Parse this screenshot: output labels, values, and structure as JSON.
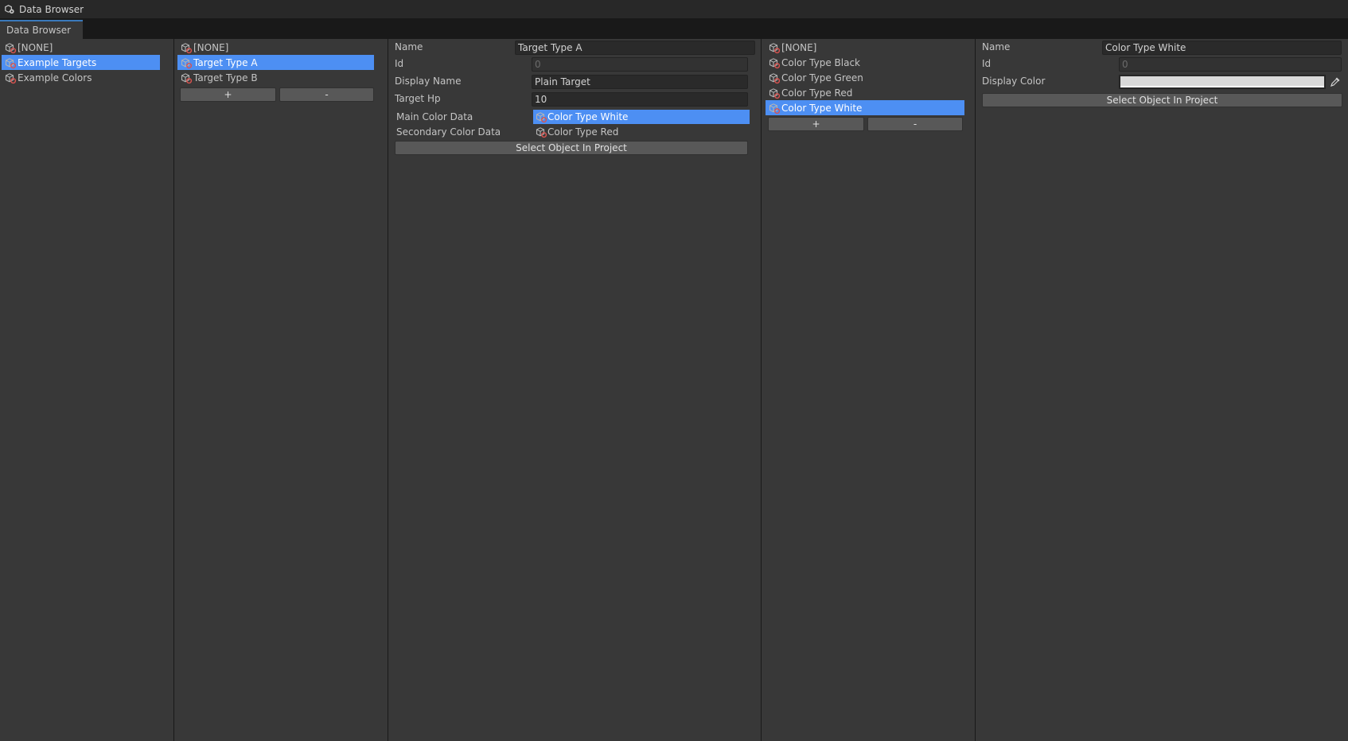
{
  "window": {
    "title": "Data Browser",
    "tab_label": "Data Browser"
  },
  "categories": {
    "items": [
      {
        "label": "[NONE]"
      },
      {
        "label": "Example Targets"
      },
      {
        "label": "Example Colors"
      }
    ],
    "selected_index": 1
  },
  "targets_list": {
    "items": [
      {
        "label": "[NONE]"
      },
      {
        "label": "Target Type A"
      },
      {
        "label": "Target Type B"
      }
    ],
    "selected_index": 1,
    "add_label": "+",
    "remove_label": "-"
  },
  "target_inspector": {
    "name_label": "Name",
    "name_value": "Target Type A",
    "id_label": "Id",
    "id_value": "0",
    "display_name_label": "Display Name",
    "display_name_value": "Plain Target",
    "target_hp_label": "Target Hp",
    "target_hp_value": "10",
    "main_color_label": "Main Color Data",
    "main_color_value": "Color Type White",
    "secondary_color_label": "Secondary Color Data",
    "secondary_color_value": "Color Type Red",
    "select_button_label": "Select Object In Project"
  },
  "colors_list": {
    "items": [
      {
        "label": "[NONE]"
      },
      {
        "label": "Color Type Black"
      },
      {
        "label": "Color Type Green"
      },
      {
        "label": "Color Type Red"
      },
      {
        "label": "Color Type White"
      }
    ],
    "selected_index": 4,
    "add_label": "+",
    "remove_label": "-"
  },
  "color_inspector": {
    "name_label": "Name",
    "name_value": "Color Type White",
    "id_label": "Id",
    "id_value": "0",
    "display_color_label": "Display Color",
    "display_color_value": "#d9d9d9",
    "select_button_label": "Select Object In Project"
  },
  "icons": {
    "app": "data-browser-icon",
    "asset": "scriptable-object-icon",
    "eyedropper": "eyedropper-icon"
  },
  "colors": {
    "selection": "#4d8ff3",
    "panel_bg": "#383838",
    "title_bg": "#282828",
    "tab_accent": "#3a79bb"
  }
}
